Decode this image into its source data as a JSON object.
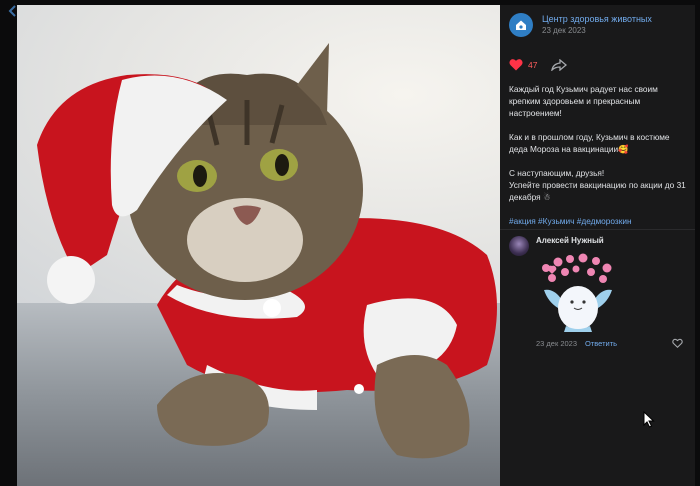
{
  "post": {
    "group_name": "Центр здоровья животных",
    "date": "23 дек 2023",
    "likes": "47",
    "text_p1": "Каждый год Кузьмич радует нас своим крепким здоровьем и прекрасным настроением!",
    "text_p2": "Как и в прошлом году, Кузьмич в костюме деда Мороза на вакцинации🥰",
    "text_p3a": "С наступающим, друзья!",
    "text_p3b": "Успейте провести вакцинацию по акции до 31 декабря ☃",
    "hashtags": "#акция #Кузьмич #дедморозкин"
  },
  "comment": {
    "author": "Алексей Нужный",
    "date": "23 дек 2023",
    "reply_label": "Ответить"
  },
  "colors": {
    "accent": "#71aaeb",
    "like": "#ff5c5c",
    "panel_bg": "#19191a"
  },
  "icons": [
    "heart-icon",
    "share-icon",
    "comment-like-icon",
    "paw-home-icon",
    "cursor-icon"
  ]
}
